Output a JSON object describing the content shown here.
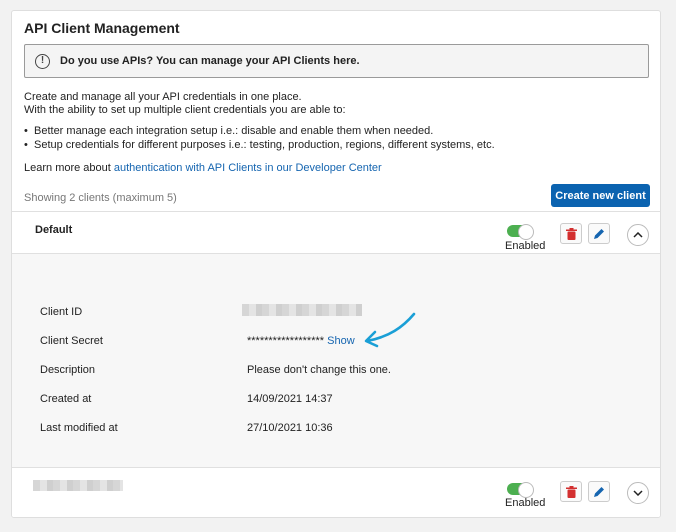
{
  "title": "API Client Management",
  "notice": {
    "icon": "exclamation-icon",
    "text": "Do you use APIs? You can manage your API Clients here."
  },
  "intro": {
    "line1": "Create and manage all your API credentials in one place.",
    "line2": "With the ability to set up multiple client credentials you are able to:"
  },
  "bullets": [
    "Better manage each integration setup i.e.: disable and enable them when needed.",
    "Setup credentials for different purposes i.e.: testing, production, regions, different systems, etc."
  ],
  "learn_more": {
    "prefix": "Learn more about ",
    "link": "authentication with API Clients in our Developer Center"
  },
  "showing": "Showing 2 clients (maximum 5)",
  "create_button": "Create new client",
  "clients": [
    {
      "name": "Default",
      "status": "Enabled",
      "enabled": true,
      "expanded": true,
      "details": {
        "client_id_label": "Client ID",
        "client_secret_label": "Client Secret",
        "client_secret_value": "******************",
        "show_link": "Show",
        "description_label": "Description",
        "description_value": "Please don't change this one.",
        "created_label": "Created at",
        "created_value": "14/09/2021 14:37",
        "modified_label": "Last modified at",
        "modified_value": "27/10/2021 10:36"
      }
    },
    {
      "name": "",
      "status": "Enabled",
      "enabled": true,
      "expanded": false
    }
  ],
  "colors": {
    "primary": "#0b63b0",
    "delete": "#d32f2f",
    "edit": "#1565b0",
    "toggle_on": "#4caf50",
    "arrow": "#1a9fd6"
  }
}
